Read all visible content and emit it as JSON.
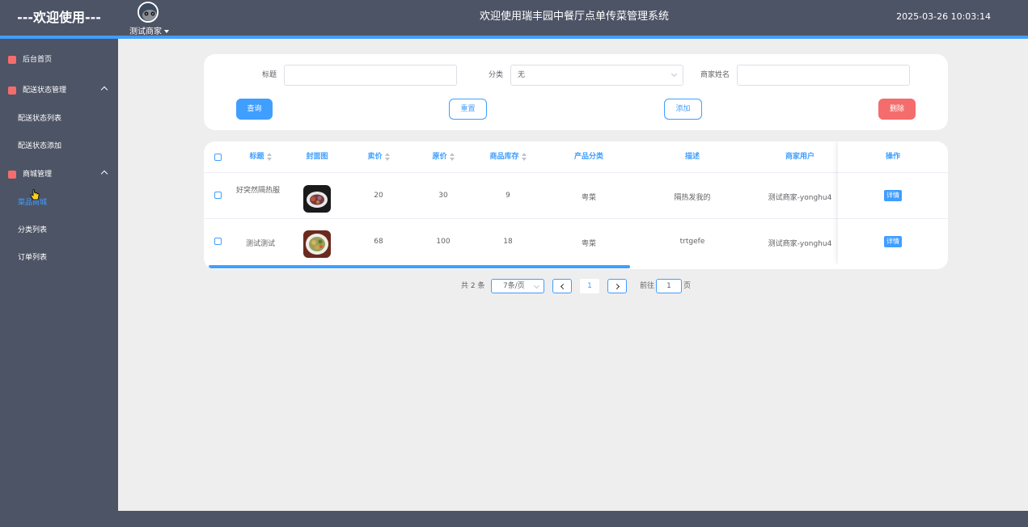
{
  "header": {
    "brand": "---欢迎使用---",
    "user_name": "测试商家",
    "system_title": "欢迎使用瑞丰园中餐厅点单传菜管理系统",
    "datetime": "2025-03-26 10:03:14"
  },
  "sidebar": {
    "items": [
      {
        "label": "后台首页",
        "icon": "monitor-icon",
        "color": "#f56c6c"
      },
      {
        "label": "配送状态管理",
        "icon": "checkbox-icon",
        "color": "#f56c6c"
      },
      {
        "label": "配送状态列表"
      },
      {
        "label": "配送状态添加"
      },
      {
        "label": "商城管理",
        "icon": "monitor-icon",
        "color": "#f56c6c"
      },
      {
        "label": "菜品商城"
      },
      {
        "label": "分类列表"
      },
      {
        "label": "订单列表"
      }
    ]
  },
  "search": {
    "title_label": "标题",
    "title_value": "",
    "category_label": "分类",
    "category_value": "无",
    "merchant_label": "商家姓名",
    "merchant_value": "",
    "btn_query": "查询",
    "btn_reset": "重置",
    "btn_add": "添加",
    "btn_delete": "删除"
  },
  "table": {
    "headers": [
      "标题",
      "封面图",
      "卖价",
      "原价",
      "商品库存",
      "产品分类",
      "描述",
      "商家用户",
      "操作"
    ],
    "rows": [
      {
        "title": "好突然隔热服",
        "price": "20",
        "original_price": "30",
        "stock": "9",
        "category": "粤菜",
        "description": "隔热发我的",
        "merchant": "测试商家-yonghu4",
        "action": "详情"
      },
      {
        "title": "测试测试",
        "price": "68",
        "original_price": "100",
        "stock": "18",
        "category": "粤菜",
        "description": "trtgefe",
        "merchant": "测试商家-yonghu4",
        "action": "详情"
      }
    ]
  },
  "pagination": {
    "total": "共 2 条",
    "page_size": "7条/页",
    "current_page": "1",
    "goto_prefix": "前往",
    "goto_value": "1",
    "goto_suffix": "页"
  },
  "colors": {
    "header_bg": "#4d5466",
    "accent": "#409eff",
    "danger": "#f56c6c"
  }
}
